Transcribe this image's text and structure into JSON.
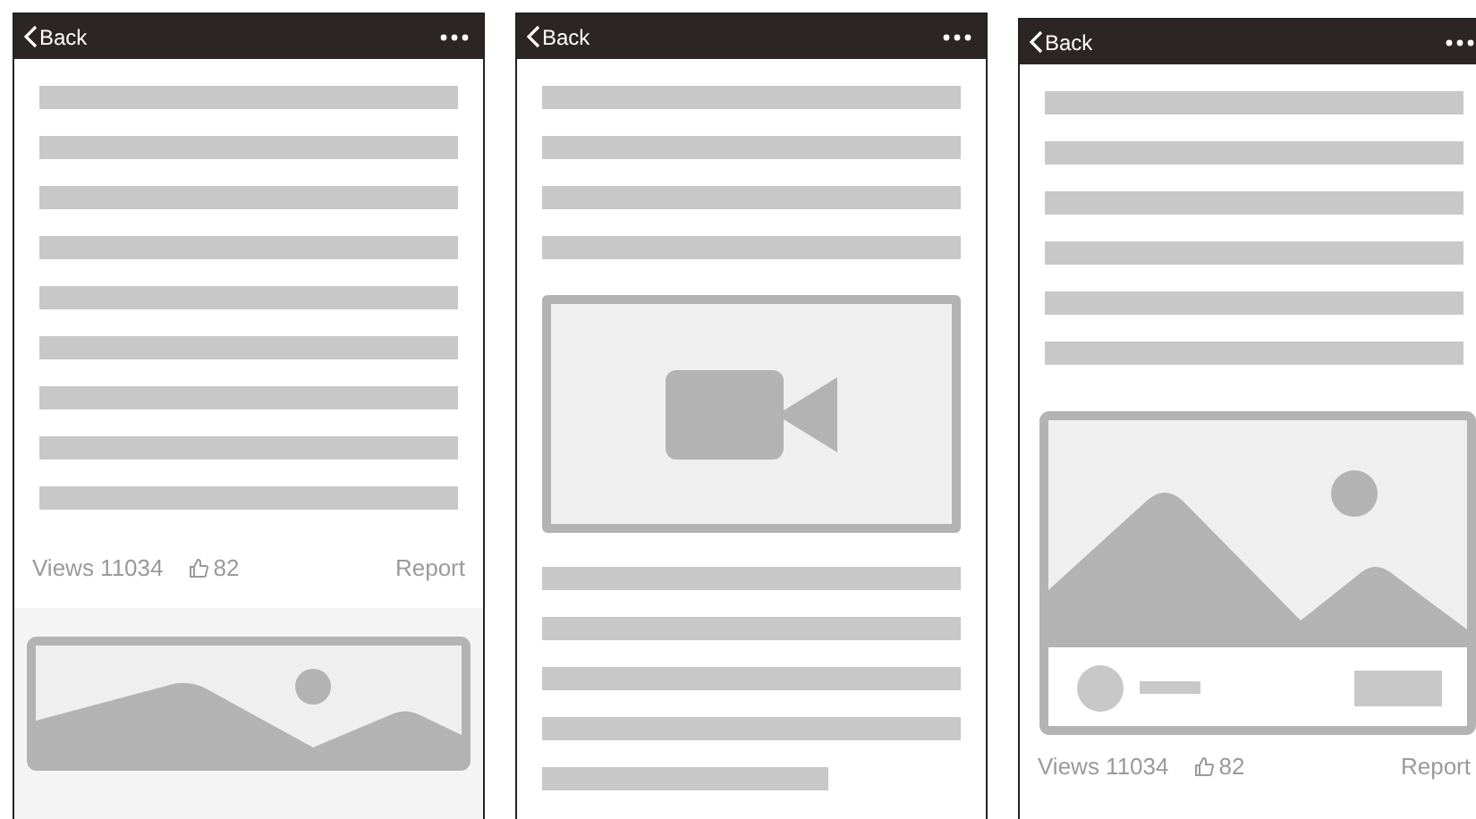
{
  "screens": [
    {
      "back_label": "Back",
      "blocks": [
        {
          "kind": "line"
        },
        {
          "kind": "line"
        },
        {
          "kind": "line"
        },
        {
          "kind": "line"
        },
        {
          "kind": "line"
        },
        {
          "kind": "line"
        },
        {
          "kind": "line"
        },
        {
          "kind": "line"
        },
        {
          "kind": "line"
        },
        {
          "kind": "stats",
          "views": "Views 11034",
          "likes": "82",
          "report": "Report"
        },
        {
          "kind": "image_banner"
        }
      ]
    },
    {
      "back_label": "Back",
      "blocks": [
        {
          "kind": "line"
        },
        {
          "kind": "line"
        },
        {
          "kind": "line"
        },
        {
          "kind": "line"
        },
        {
          "kind": "video"
        },
        {
          "kind": "line"
        },
        {
          "kind": "line"
        },
        {
          "kind": "line"
        },
        {
          "kind": "line"
        },
        {
          "kind": "line_short"
        }
      ]
    },
    {
      "back_label": "Back",
      "blocks": [
        {
          "kind": "line"
        },
        {
          "kind": "line"
        },
        {
          "kind": "line"
        },
        {
          "kind": "line"
        },
        {
          "kind": "line"
        },
        {
          "kind": "line"
        },
        {
          "kind": "image_card"
        },
        {
          "kind": "stats",
          "views": "Views 11034",
          "likes": "82",
          "report": "Report"
        }
      ]
    }
  ]
}
